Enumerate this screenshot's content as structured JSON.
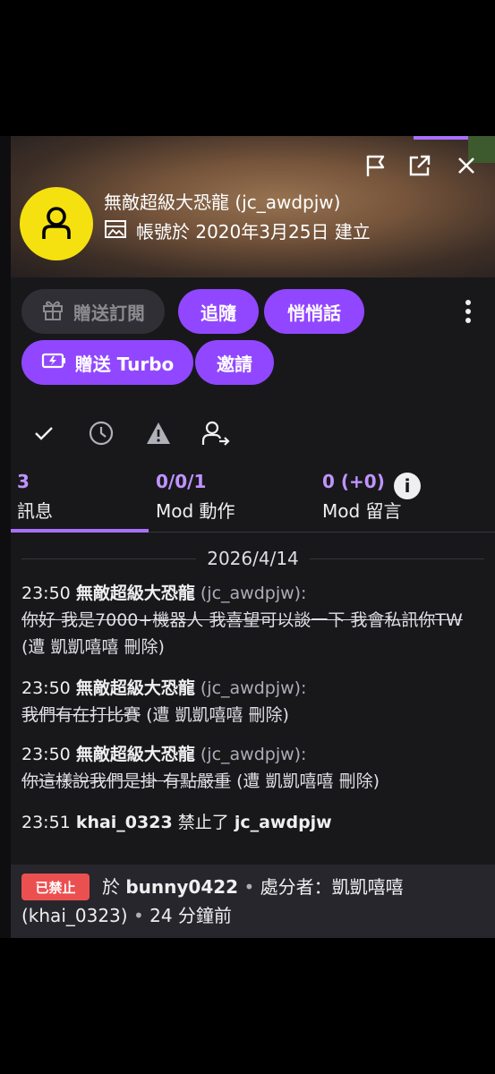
{
  "card": {
    "display_name": "無敵超級大恐龍",
    "login": "(jc_awdpjw)",
    "created_text": "帳號於 2020年3月25日 建立"
  },
  "actions": {
    "gift_sub": "贈送訂閱",
    "follow": "追隨",
    "whisper": "悄悄話",
    "gift_turbo": "贈送 Turbo",
    "invite": "邀請"
  },
  "mod_icons": [
    "check-icon",
    "clock-icon",
    "warning-icon",
    "user-add-icon"
  ],
  "stats": {
    "messages": {
      "value": "3",
      "label": "訊息"
    },
    "mod_actions": {
      "value": "0/0/1",
      "label": "Mod 動作"
    },
    "mod_comments": {
      "value": "0 (+0)",
      "label": "Mod 留言"
    },
    "info_glyph": "i"
  },
  "log": {
    "date": "2026/4/14",
    "messages": [
      {
        "time": "23:50",
        "user": "無敵超級大恐龍",
        "login": "(jc_awdpjw):",
        "text": "你好 我是7000+機器人 我喜望可以談一下 我會私訊你TW",
        "meta": "(遭 凱凱嘻嘻 刪除)"
      },
      {
        "time": "23:50",
        "user": "無敵超級大恐龍",
        "login": "(jc_awdpjw):",
        "text": "我們有在打比賽",
        "meta": "(遭 凱凱嘻嘻 刪除)"
      },
      {
        "time": "23:50",
        "user": "無敵超級大恐龍",
        "login": "(jc_awdpjw):",
        "text": "你這樣說我們是掛 有點嚴重",
        "meta": "(遭 凱凱嘻嘻 刪除)"
      }
    ],
    "ban_event": {
      "time": "23:51",
      "moderator": "khai_0323",
      "action": "禁止了",
      "target": "jc_awdpjw"
    }
  },
  "footer": {
    "badge": "已禁止",
    "in_word": "於",
    "channel": "bunny0422",
    "dot": "•",
    "by_label": "處分者：凱凱嘻嘻",
    "by_login": "(khai_0323)",
    "ago": "24 分鐘前"
  },
  "colors": {
    "accent": "#9147ff",
    "accent_light": "#bf94ff",
    "avatar": "#f5e10f",
    "banned": "#eb5050",
    "bg": "#18181b"
  }
}
